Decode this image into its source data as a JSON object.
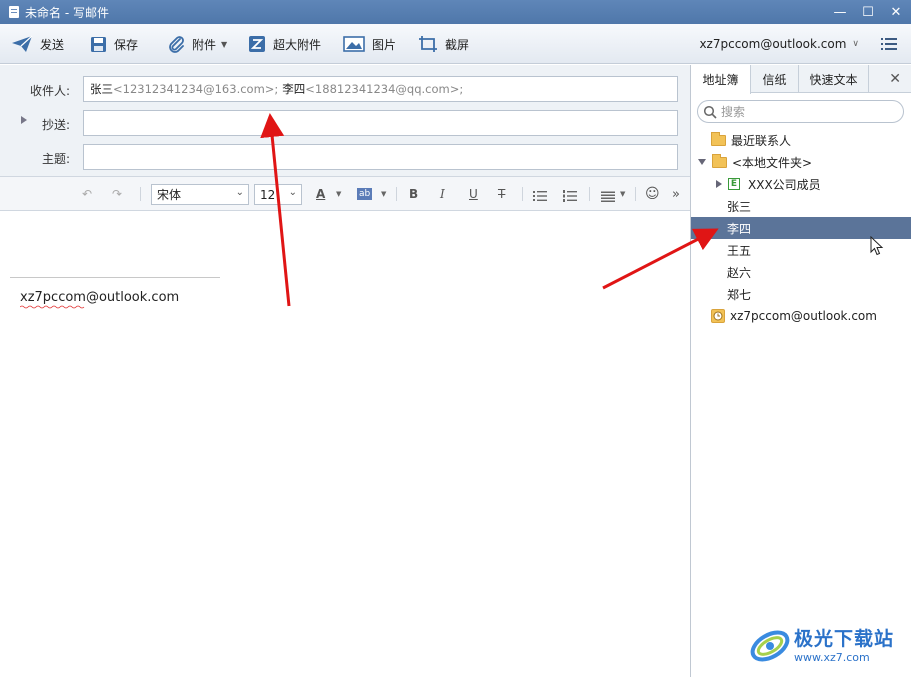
{
  "window": {
    "title": "未命名 - 写邮件",
    "min_glyph": "—",
    "max_glyph": "☐",
    "close_glyph": "✕"
  },
  "toolbar": {
    "send_label": "发送",
    "save_label": "保存",
    "attach_label": "附件",
    "big_attach_label": "超大附件",
    "image_label": "图片",
    "screenshot_label": "截屏",
    "account": "xz7pccom@outlook.com",
    "account_chevron": "∨"
  },
  "fields": {
    "to_label": "收件人:",
    "to_recipients": [
      {
        "name": "张三",
        "address": "<12312341234@163.com>"
      },
      {
        "name": "李四",
        "address": "<18812341234@qq.com>"
      }
    ],
    "separator": ";",
    "cc_label": "抄送:",
    "cc_value": "",
    "subject_label": "主题:",
    "subject_value": ""
  },
  "format": {
    "undo": "↶",
    "redo": "↷",
    "font_family": "宋体",
    "font_size": "12",
    "font_color_glyph": "A",
    "highlight_glyph": "ab",
    "bold": "B",
    "italic": "I",
    "underline": "U",
    "strike": "T",
    "emoji": "☺",
    "more": "»",
    "dropdown_glyph": "⌄"
  },
  "body": {
    "signature": "xz7pccom@outlook.com"
  },
  "panel": {
    "tabs": [
      "地址簿",
      "信纸",
      "快速文本"
    ],
    "close_glyph": "✕",
    "search_placeholder": "搜索",
    "tree": {
      "recent": "最近联系人",
      "local": "<本地文件夹>",
      "group": "XXX公司成员",
      "group_icon_letter": "E",
      "contacts": [
        "张三",
        "李四",
        "王五",
        "赵六",
        "郑七"
      ],
      "selected": "李四",
      "account": "xz7pccom@outlook.com"
    }
  },
  "watermark": {
    "text": "极光下载站",
    "url": "www.xz7.com"
  },
  "colors": {
    "titlebar": "#5377ab",
    "selection": "#5b7499",
    "arrow": "#e01515",
    "watermark": "#2b72c9"
  }
}
